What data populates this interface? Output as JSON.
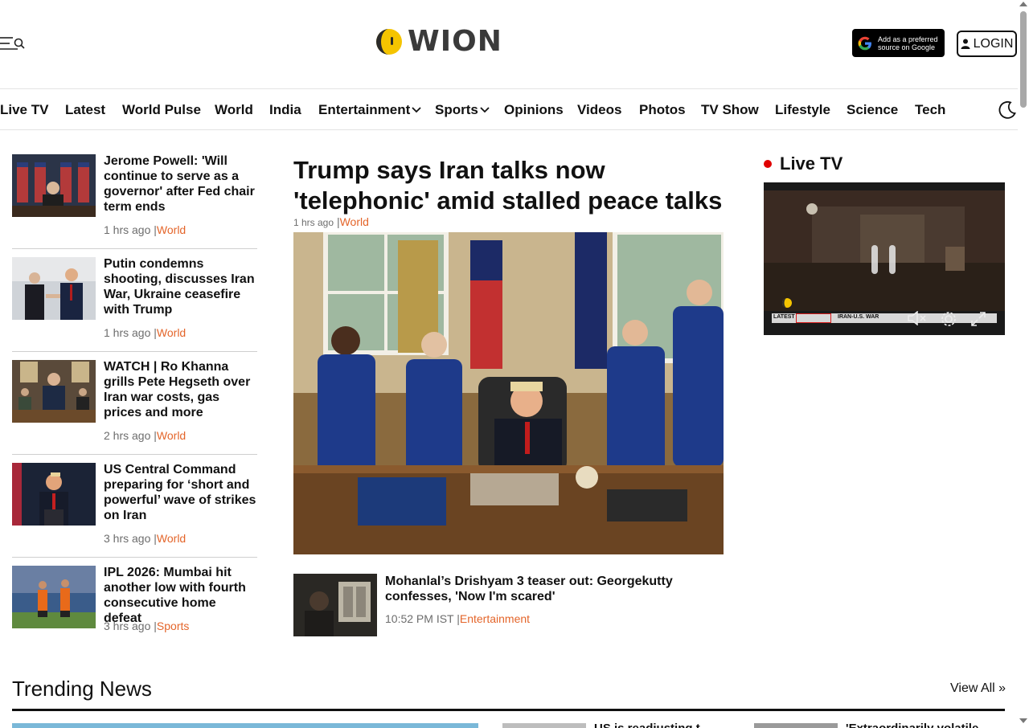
{
  "header": {
    "logo_text": "WION",
    "google_badge": {
      "line1": "Add as a preferred",
      "line2": "source on Google"
    },
    "login_label": "LOGIN"
  },
  "nav": {
    "items": [
      {
        "label": "Live TV"
      },
      {
        "label": "Latest"
      },
      {
        "label": "World Pulse"
      },
      {
        "label": "World"
      },
      {
        "label": "India"
      },
      {
        "label": "Entertainment",
        "has_dropdown": true
      },
      {
        "label": "Sports",
        "has_dropdown": true
      },
      {
        "label": "Opinions"
      },
      {
        "label": "Videos"
      },
      {
        "label": "Photos"
      },
      {
        "label": "TV Show"
      },
      {
        "label": "Lifestyle"
      },
      {
        "label": "Science"
      },
      {
        "label": "Tech"
      }
    ]
  },
  "left_stories": [
    {
      "title": "Jerome Powell: 'Will continue to serve as a governor' after Fed chair term ends",
      "time": "1 hrs ago",
      "sep": "|",
      "category": "World"
    },
    {
      "title": "Putin condemns shooting, discusses Iran War, Ukraine ceasefire with Trump",
      "time": "1 hrs ago",
      "sep": "|",
      "category": "World"
    },
    {
      "title": "WATCH | Ro Khanna grills Pete Hegseth over Iran war costs, gas prices and more",
      "time": "2 hrs ago",
      "sep": "|",
      "category": "World"
    },
    {
      "title": "US Central Command preparing for ‘short and powerful’ wave of strikes on Iran",
      "time": "3 hrs ago",
      "sep": "|",
      "category": "World"
    },
    {
      "title": "IPL 2026: Mumbai hit another low with fourth consecutive home defeat",
      "time": "3 hrs ago",
      "sep": "|",
      "category": "Sports"
    }
  ],
  "hero": {
    "title": "Trump says Iran talks now 'telephonic' amid stalled peace talks",
    "time": "1 hrs ago",
    "sep": "|",
    "category": "World"
  },
  "sub_story": {
    "title": "Mohanlal’s Drishyam 3 teaser out: Georgekutty confesses, 'Now I'm scared'",
    "time": "10:52 PM IST",
    "sep": "|",
    "category": "Entertainment"
  },
  "live_tv": {
    "heading": "Live TV",
    "ticker_left": "LATEST",
    "ticker_right": "IRAN-U.S. WAR"
  },
  "trending": {
    "title": "Trending News",
    "view_all": "View All »",
    "cards": [
      {
        "title": "US is readjusting t..."
      },
      {
        "title": "'Extraordinarily volatile..."
      }
    ]
  },
  "colors": {
    "accent": "#e4652a",
    "live_dot": "#e00000",
    "text": "#111111",
    "meta": "#6d6d6d"
  }
}
